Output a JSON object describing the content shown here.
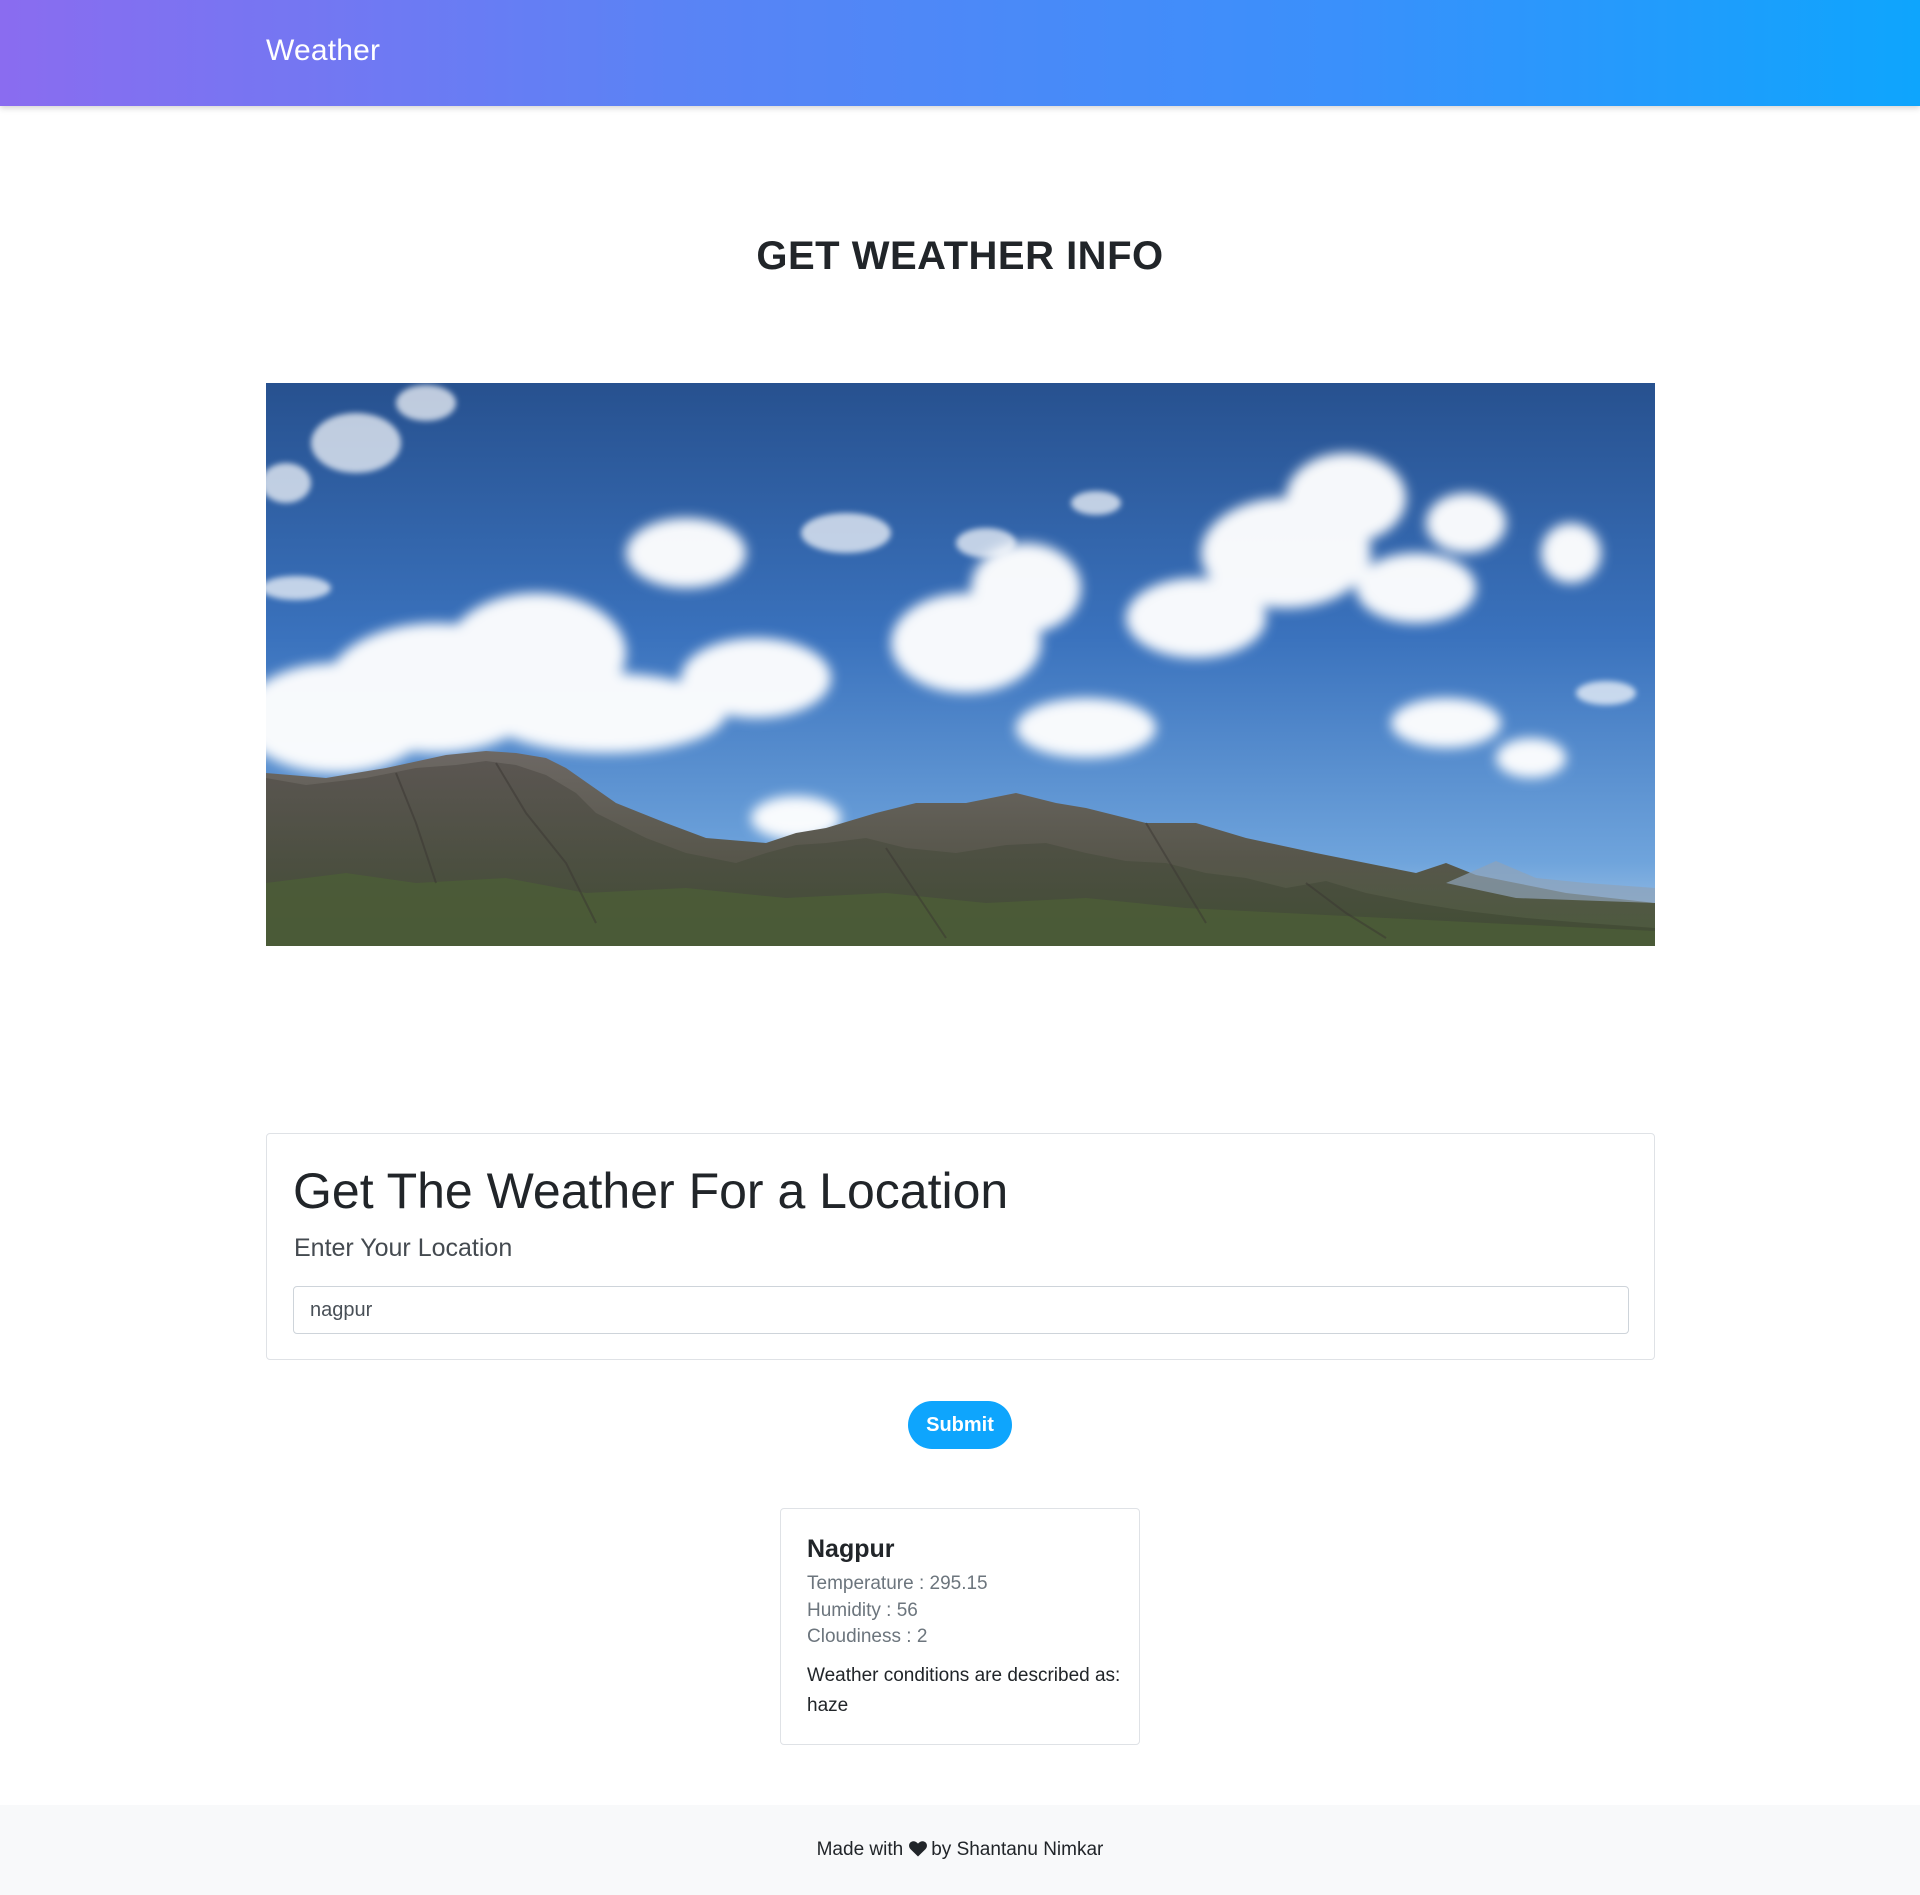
{
  "navbar": {
    "brand": "Weather",
    "gradient_start": "#8a6cf0",
    "gradient_end": "#0ea5fd"
  },
  "page": {
    "heading": "GET WEATHER INFO"
  },
  "hero": {
    "icon": "mountain-sky-image"
  },
  "form": {
    "title": "Get The Weather For a Location",
    "subtitle": "Enter Your Location",
    "location_value": "nagpur",
    "submit_label": "Submit",
    "accent": "#0ea5fd"
  },
  "result": {
    "city": "Nagpur",
    "temperature": "Temperature : 295.15",
    "humidity": "Humidity : 56",
    "cloudiness": "Cloudiness : 2",
    "description": "Weather conditions are described as: haze"
  },
  "footer": {
    "text_before": "Made with",
    "icon": "heart-icon",
    "text_after": "by Shantanu Nimkar"
  }
}
